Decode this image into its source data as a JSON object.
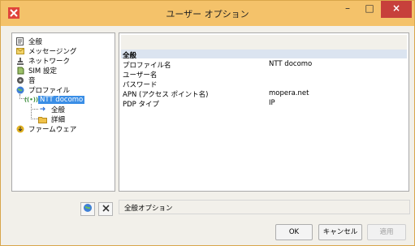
{
  "window": {
    "title": "ユーザー オプション",
    "minimize": "–",
    "maximize": "□",
    "close": "×"
  },
  "tree": {
    "items": [
      {
        "label": "全般",
        "icon": "document-icon"
      },
      {
        "label": "メッセージング",
        "icon": "envelope-icon"
      },
      {
        "label": "ネットワーク",
        "icon": "network-icon"
      },
      {
        "label": "SIM 設定",
        "icon": "sim-icon"
      },
      {
        "label": "音",
        "icon": "sound-icon"
      },
      {
        "label": "プロファイル",
        "icon": "globe-icon"
      },
      {
        "label": "NTT docomo",
        "icon": "signal-icon"
      },
      {
        "label": "全般",
        "icon": "arrow-right-icon"
      },
      {
        "label": "詳細",
        "icon": "folder-icon"
      },
      {
        "label": "ファームウェア",
        "icon": "download-icon"
      }
    ]
  },
  "detail": {
    "section": "全般",
    "rows": [
      {
        "label": "プロファイル名",
        "value": "NTT docomo"
      },
      {
        "label": "ユーザー名",
        "value": ""
      },
      {
        "label": "パスワード",
        "value": ""
      },
      {
        "label": "APN (アクセス ポイント名)",
        "value": "mopera.net"
      },
      {
        "label": "PDP タイプ",
        "value": "IP"
      }
    ]
  },
  "description": "全般オプション",
  "buttons": {
    "ok": "OK",
    "cancel": "キャンセル",
    "apply": "適用"
  },
  "colors": {
    "titlebar": "#f4c26a",
    "close": "#c7403b",
    "selection": "#3a8ee6",
    "section_band": "#dbe4f0"
  }
}
